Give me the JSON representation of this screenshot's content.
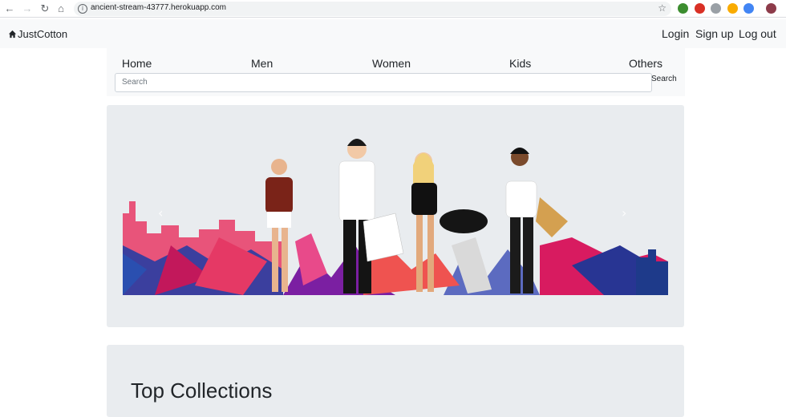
{
  "browser": {
    "url": "ancient-stream-43777.herokuapp.com",
    "back_icon": "arrow-left-icon",
    "forward_icon": "arrow-right-icon",
    "reload_icon": "reload-icon",
    "home_icon": "home-icon"
  },
  "navbar": {
    "brand": "JustCotton",
    "login": "Login",
    "signup": "Sign up",
    "logout": "Log out"
  },
  "categories": {
    "home": "Home",
    "men": "Men",
    "women": "Women",
    "kids": "Kids",
    "others": "Others"
  },
  "search": {
    "placeholder": "Search",
    "button": "Search"
  },
  "carousel": {
    "prev": "‹",
    "next": "›"
  },
  "collections": {
    "title": "Top Collections"
  },
  "colors": {
    "navbar_bg": "#f8f9fa",
    "jumbotron_bg": "#e9ecef",
    "text": "#212529"
  }
}
